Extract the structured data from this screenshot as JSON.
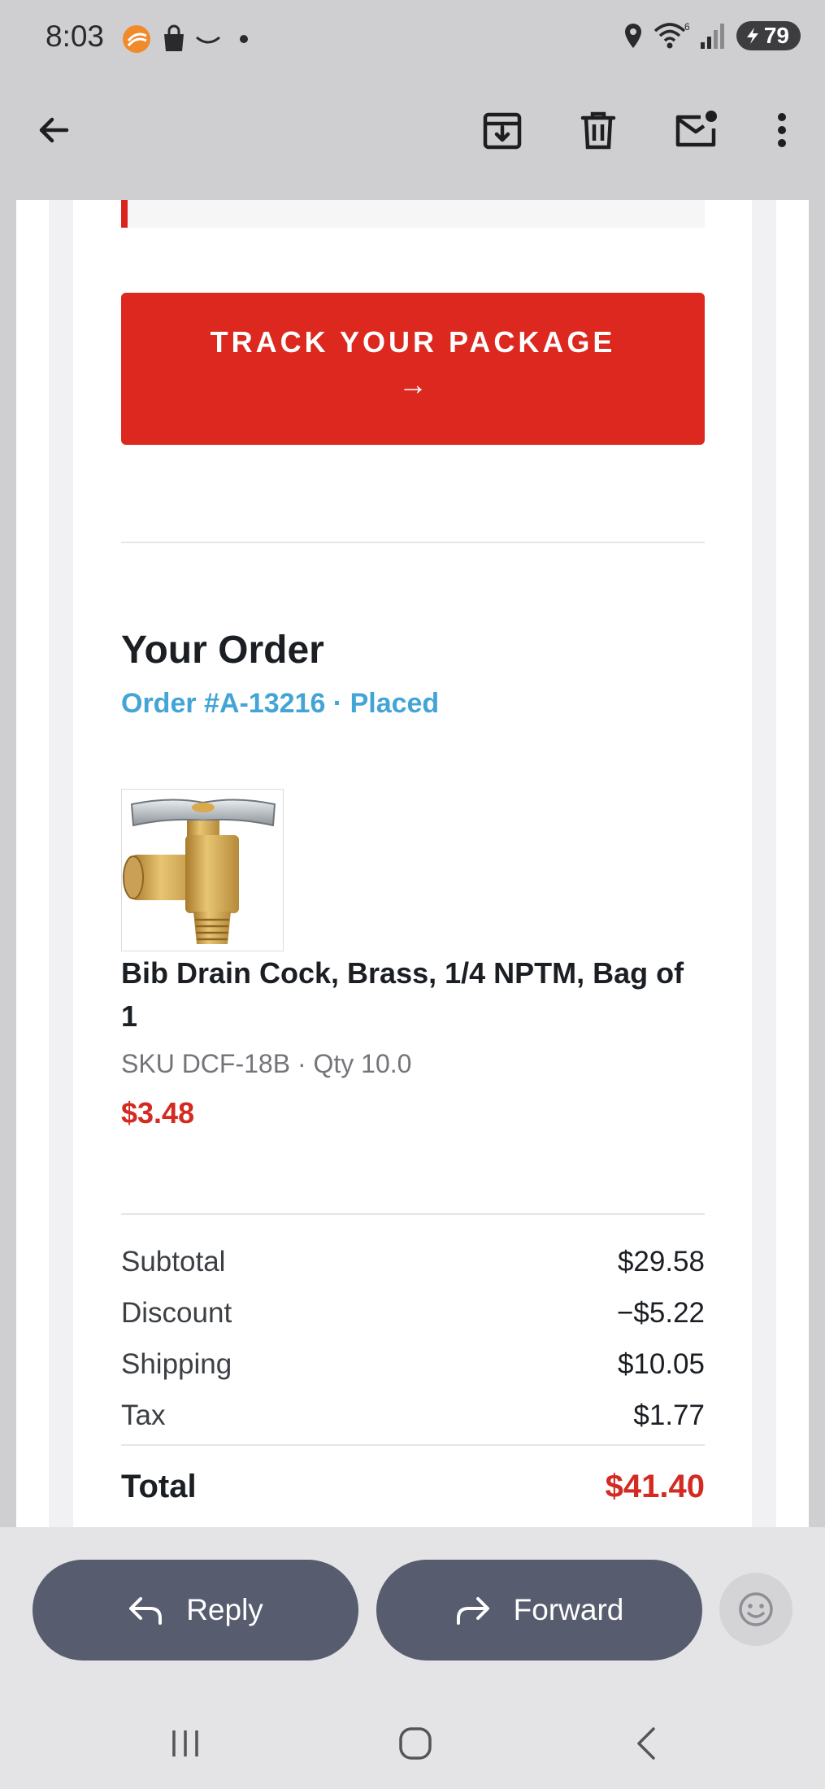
{
  "status_bar": {
    "time": "8:03",
    "battery": "79",
    "wifi_label": "6"
  },
  "toolbar": {
    "icons": [
      "back-arrow-icon",
      "archive-icon",
      "delete-icon",
      "mark-unread-icon",
      "more-vertical-icon"
    ]
  },
  "email": {
    "track_button": {
      "label": "TRACK YOUR PACKAGE",
      "arrow": "→",
      "color": "#dc281e"
    },
    "order": {
      "title": "Your Order",
      "subtitle": "Order #A-13216 · Placed"
    },
    "product": {
      "name": "Bib Drain Cock, Brass, 1/4 NPTM, Bag of 1",
      "meta": "SKU DCF-18B · Qty 10.0",
      "price": "$3.48"
    },
    "summary": {
      "rows": [
        {
          "label": "Subtotal",
          "value": "$29.58"
        },
        {
          "label": "Discount",
          "value": "−$5.22"
        },
        {
          "label": "Shipping",
          "value": "$10.05"
        },
        {
          "label": "Tax",
          "value": "$1.77"
        }
      ],
      "total_label": "Total",
      "total_value": "$41.40"
    }
  },
  "actions": {
    "reply_label": "Reply",
    "forward_label": "Forward"
  },
  "colors": {
    "accent_red": "#dc281e",
    "link_blue": "#43a4d6",
    "button_dark": "#575c6e"
  }
}
